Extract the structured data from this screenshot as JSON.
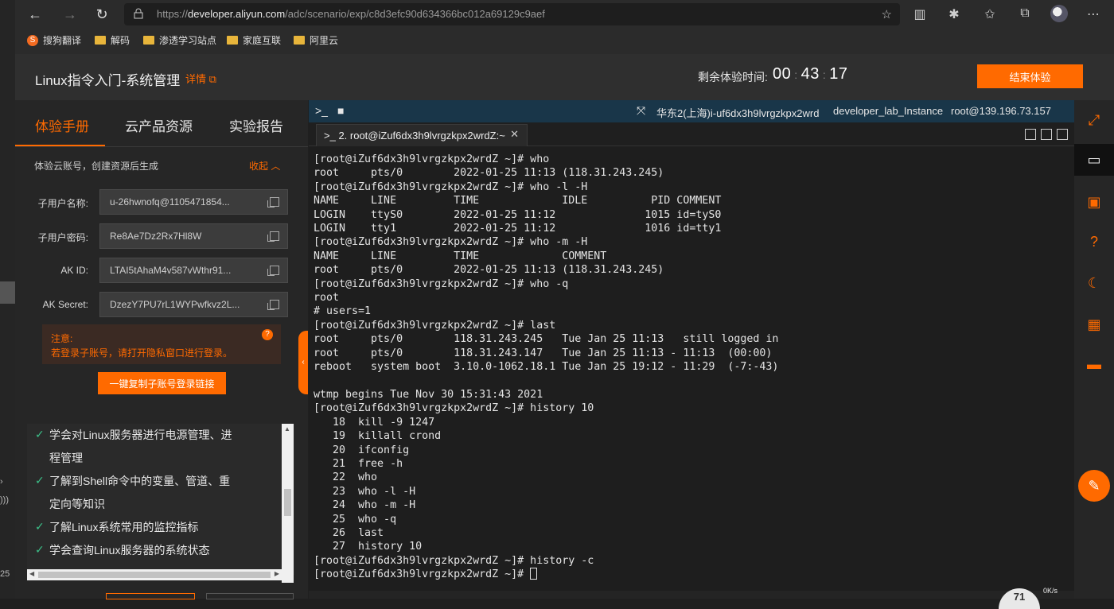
{
  "browser": {
    "url_prefix": "https://",
    "url_host": "developer.aliyun.com",
    "url_path": "/adc/scenario/exp/c8d3efc90d634366bc012a69129c9aef",
    "bookmarks": [
      "搜狗翻译",
      "解码",
      "渗透学习站点",
      "家庭互联",
      "阿里云"
    ]
  },
  "header": {
    "title": "Linux指令入门-系统管理",
    "detail": "详情",
    "timer_label": "剩余体验时间:",
    "timer": {
      "h": "00",
      "m": "43",
      "s": "17"
    },
    "end_button": "结束体验"
  },
  "left_panel": {
    "tabs": [
      "体验手册",
      "云产品资源",
      "实验报告"
    ],
    "account_note": "体验云账号，创建资源后生成",
    "collapse": "收起",
    "fields": [
      {
        "label": "子用户名称:",
        "value": "u-26hwnofq@1105471854..."
      },
      {
        "label": "子用户密码:",
        "value": "Re8Ae7Dz2Rx7Hl8W"
      },
      {
        "label": "AK ID:",
        "value": "LTAI5tAhaM4v587vWthr91..."
      },
      {
        "label": "AK Secret:",
        "value": "DzezY7PU7rL1WYPwfkvz2L..."
      }
    ],
    "warning_title": "注意:",
    "warning_text": "若登录子账号，请打开隐私窗口进行登录。",
    "copy_link_button": "一键复制子账号登录链接",
    "goals": [
      {
        "line1": "学会对Linux服务器进行电源管理、进",
        "line2": "程管理"
      },
      {
        "line1": "了解到Shell命令中的变量、管道、重",
        "line2": "定向等知识"
      },
      {
        "line1": "了解Linux系统常用的监控指标",
        "line2": ""
      },
      {
        "line1": "学会查询Linux服务器的系统状态",
        "line2": ""
      }
    ]
  },
  "terminal": {
    "toolbar_region": "华东2(上海)",
    "toolbar_instance": "i-uf6dx3h9lvrgzkpx2wrd",
    "toolbar_name": "developer_lab_Instance",
    "toolbar_login": "root@139.196.73.157",
    "tab_title": "2. root@iZuf6dx3h9lvrgzkpx2wrdZ:~",
    "lines": [
      "[root@iZuf6dx3h9lvrgzkpx2wrdZ ~]# who",
      "root     pts/0        2022-01-25 11:13 (118.31.243.245)",
      "[root@iZuf6dx3h9lvrgzkpx2wrdZ ~]# who -l -H",
      "NAME     LINE         TIME             IDLE          PID COMMENT",
      "LOGIN    ttyS0        2022-01-25 11:12              1015 id=tyS0",
      "LOGIN    tty1         2022-01-25 11:12              1016 id=tty1",
      "[root@iZuf6dx3h9lvrgzkpx2wrdZ ~]# who -m -H",
      "NAME     LINE         TIME             COMMENT",
      "root     pts/0        2022-01-25 11:13 (118.31.243.245)",
      "[root@iZuf6dx3h9lvrgzkpx2wrdZ ~]# who -q",
      "root",
      "# users=1",
      "[root@iZuf6dx3h9lvrgzkpx2wrdZ ~]# last",
      "root     pts/0        118.31.243.245   Tue Jan 25 11:13   still logged in",
      "root     pts/0        118.31.243.147   Tue Jan 25 11:13 - 11:13  (00:00)",
      "reboot   system boot  3.10.0-1062.18.1 Tue Jan 25 19:12 - 11:29  (-7:-43)",
      "",
      "wtmp begins Tue Nov 30 15:31:43 2021",
      "[root@iZuf6dx3h9lvrgzkpx2wrdZ ~]# history 10",
      "   18  kill -9 1247",
      "   19  killall crond",
      "   20  ifconfig",
      "   21  free -h",
      "   22  who",
      "   23  who -l -H",
      "   24  who -m -H",
      "   25  who -q",
      "   26  last",
      "   27  history 10",
      "[root@iZuf6dx3h9lvrgzkpx2wrdZ ~]# history -c",
      "[root@iZuf6dx3h9lvrgzkpx2wrdZ ~]# "
    ]
  },
  "status": {
    "speed": "0K/s",
    "gauge": "71"
  },
  "colors": {
    "accent": "#ff6a00",
    "terminal_bg": "#1e1e1e",
    "toolbar_bg": "#193649",
    "check": "#3cc28a"
  }
}
